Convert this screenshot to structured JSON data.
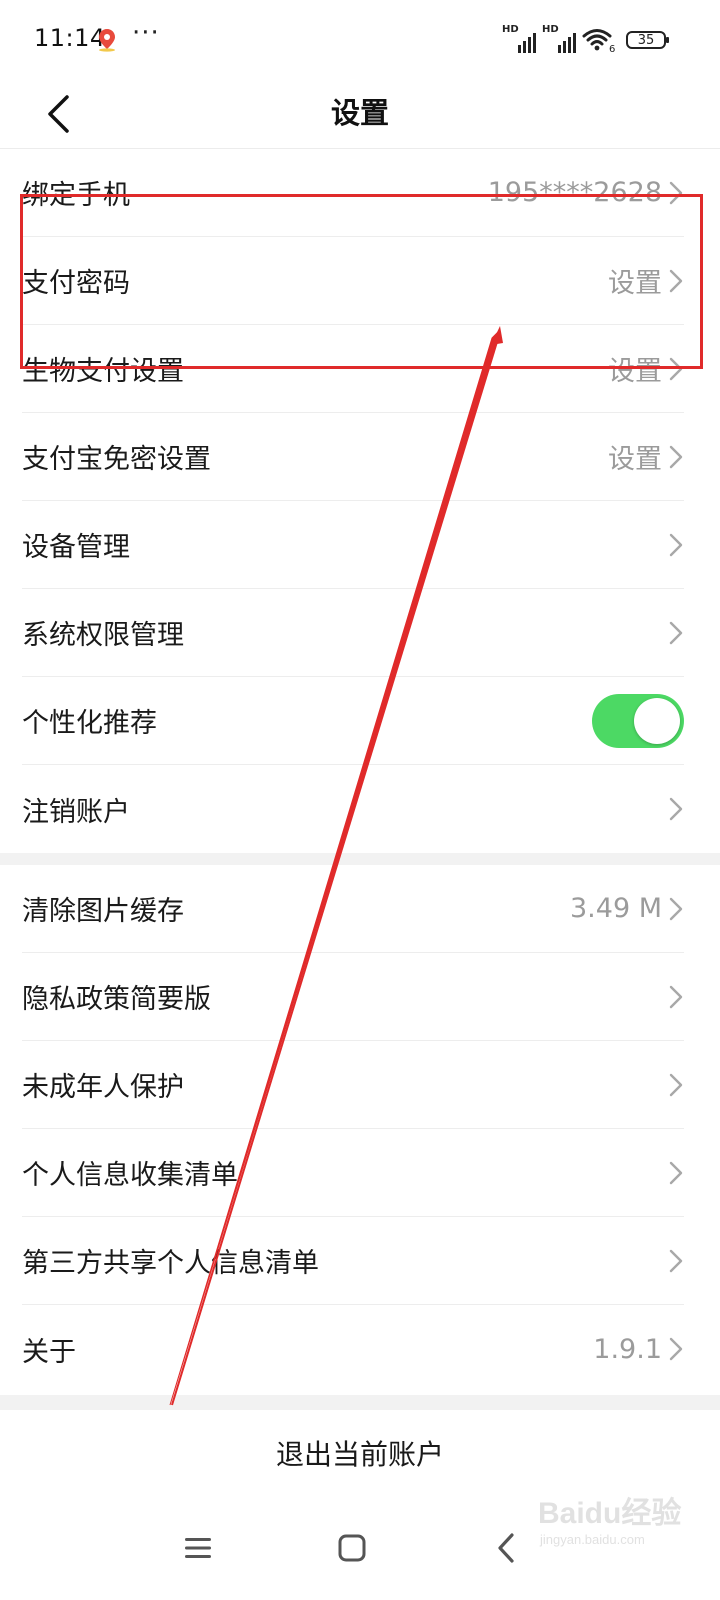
{
  "status_bar": {
    "time": "11:14",
    "more": "···",
    "signal1_label": "HD",
    "signal2_label": "HD",
    "wifi_sub": "6",
    "battery": "35"
  },
  "header": {
    "title": "设置"
  },
  "section1": [
    {
      "label": "绑定手机",
      "value": "195****2628",
      "control": "chevron"
    },
    {
      "label": "支付密码",
      "value": "设置",
      "control": "chevron"
    },
    {
      "label": "生物支付设置",
      "value": "设置",
      "control": "chevron"
    },
    {
      "label": "支付宝免密设置",
      "value": "设置",
      "control": "chevron"
    },
    {
      "label": "设备管理",
      "value": "",
      "control": "chevron"
    },
    {
      "label": "系统权限管理",
      "value": "",
      "control": "chevron"
    },
    {
      "label": "个性化推荐",
      "value": "",
      "control": "toggle",
      "toggle_on": true
    },
    {
      "label": "注销账户",
      "value": "",
      "control": "chevron"
    }
  ],
  "section2": [
    {
      "label": "清除图片缓存",
      "value": "3.49 M",
      "control": "chevron"
    },
    {
      "label": "隐私政策简要版",
      "value": "",
      "control": "chevron"
    },
    {
      "label": "未成年人保护",
      "value": "",
      "control": "chevron"
    },
    {
      "label": "个人信息收集清单",
      "value": "",
      "control": "chevron"
    },
    {
      "label": "第三方共享个人信息清单",
      "value": "",
      "control": "chevron"
    },
    {
      "label": "关于",
      "value": "1.9.1",
      "control": "chevron"
    }
  ],
  "logout_label": "退出当前账户",
  "nav": {
    "menu_icon": "menu-icon",
    "home_icon": "home-square-icon",
    "back_icon": "back-chevron-icon"
  },
  "watermark": {
    "logo": "Baidu经验",
    "url": "jingyan.baidu.com"
  },
  "colors": {
    "toggle_on": "#4cd964",
    "annotation": "#e02a2a",
    "secondary_text": "#9b9b9b"
  }
}
